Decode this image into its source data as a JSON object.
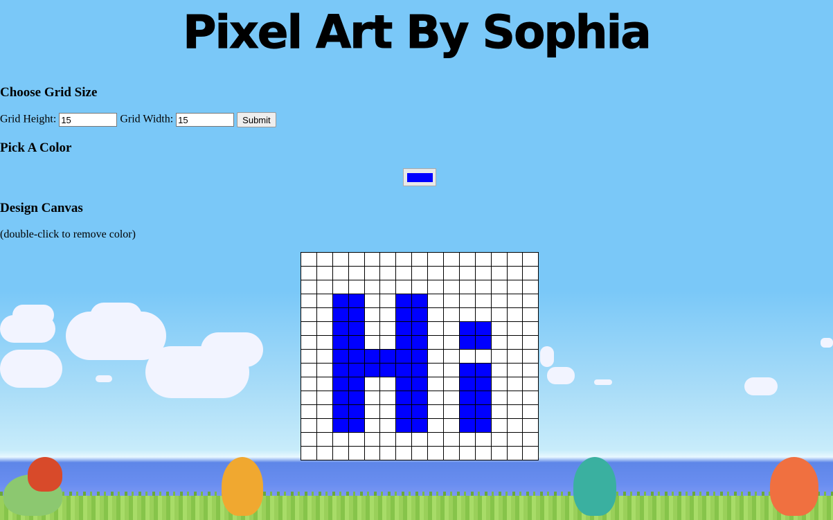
{
  "app": {
    "title": "Pixel Art By Sophia"
  },
  "grid_size": {
    "heading": "Choose Grid Size",
    "height_label": "Grid Height:",
    "height_value": "15",
    "width_label": "Grid Width:",
    "width_value": "15",
    "submit_label": "Submit"
  },
  "color": {
    "heading": "Pick A Color",
    "selected": "#0000ff"
  },
  "canvas": {
    "heading": "Design Canvas",
    "hint": "(double-click to remove color)",
    "rows": 15,
    "cols": 15,
    "fill_color": "#0000ff",
    "filled_cells": [
      [
        3,
        2
      ],
      [
        3,
        3
      ],
      [
        3,
        6
      ],
      [
        3,
        7
      ],
      [
        4,
        2
      ],
      [
        4,
        3
      ],
      [
        4,
        6
      ],
      [
        4,
        7
      ],
      [
        5,
        2
      ],
      [
        5,
        3
      ],
      [
        5,
        6
      ],
      [
        5,
        7
      ],
      [
        5,
        10
      ],
      [
        5,
        11
      ],
      [
        6,
        2
      ],
      [
        6,
        3
      ],
      [
        6,
        6
      ],
      [
        6,
        7
      ],
      [
        6,
        10
      ],
      [
        6,
        11
      ],
      [
        7,
        2
      ],
      [
        7,
        3
      ],
      [
        7,
        4
      ],
      [
        7,
        5
      ],
      [
        7,
        6
      ],
      [
        7,
        7
      ],
      [
        8,
        2
      ],
      [
        8,
        3
      ],
      [
        8,
        4
      ],
      [
        8,
        5
      ],
      [
        8,
        6
      ],
      [
        8,
        7
      ],
      [
        8,
        10
      ],
      [
        8,
        11
      ],
      [
        9,
        2
      ],
      [
        9,
        3
      ],
      [
        9,
        6
      ],
      [
        9,
        7
      ],
      [
        9,
        10
      ],
      [
        9,
        11
      ],
      [
        10,
        2
      ],
      [
        10,
        3
      ],
      [
        10,
        6
      ],
      [
        10,
        7
      ],
      [
        10,
        10
      ],
      [
        10,
        11
      ],
      [
        11,
        2
      ],
      [
        11,
        3
      ],
      [
        11,
        6
      ],
      [
        11,
        7
      ],
      [
        11,
        10
      ],
      [
        11,
        11
      ],
      [
        12,
        2
      ],
      [
        12,
        3
      ],
      [
        12,
        6
      ],
      [
        12,
        7
      ],
      [
        12,
        10
      ],
      [
        12,
        11
      ]
    ]
  }
}
